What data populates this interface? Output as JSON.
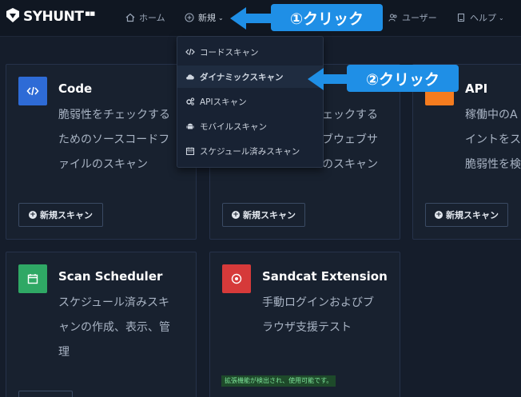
{
  "brand": {
    "logo_text": "SYHUNT"
  },
  "nav": {
    "home": "ホーム",
    "new": "新規",
    "users": "ユーザー",
    "help": "ヘルプ"
  },
  "dropdown": {
    "items": [
      {
        "icon": "code-icon",
        "label": "コードスキャン"
      },
      {
        "icon": "cloud-icon",
        "label": "ダイナミックスキャン"
      },
      {
        "icon": "gears-icon",
        "label": "APIスキャン"
      },
      {
        "icon": "android-icon",
        "label": "モバイルスキャン"
      },
      {
        "icon": "calendar-icon",
        "label": "スケジュール済みスキャン"
      }
    ]
  },
  "cards": {
    "code": {
      "title": "Code",
      "desc_lines": [
        "脆弱性をチェックする",
        "ためのソースコードフ",
        "ァイルのスキャン"
      ],
      "button": "新規スキャン",
      "icon_color": "#2e6bd6"
    },
    "dynamic": {
      "desc_lines": [
        "ェックする",
        "ブウェブサ",
        "のスキャン"
      ],
      "button": "新規スキャン"
    },
    "api": {
      "title": "API",
      "desc_lines": [
        "稼働中のA",
        "イントをス",
        "脆弱性を検"
      ],
      "button": "新規スキャン",
      "icon_color": "#f57c1f"
    },
    "scheduler": {
      "title": "Scan Scheduler",
      "desc_lines": [
        "スケジュール済みスキ",
        "ャンの作成、表示、管",
        "理"
      ],
      "icon_color": "#2fa865"
    },
    "sandcat": {
      "title": "Sandcat Extension",
      "desc_lines": [
        "手動ログインおよびブ",
        "ラウザ支援テスト"
      ],
      "status": "拡張機能が検出され、使用可能です。",
      "icon_color": "#d63a3a"
    }
  },
  "callouts": {
    "first": "①クリック",
    "second": "②クリック",
    "color": "#1f8fe6"
  }
}
